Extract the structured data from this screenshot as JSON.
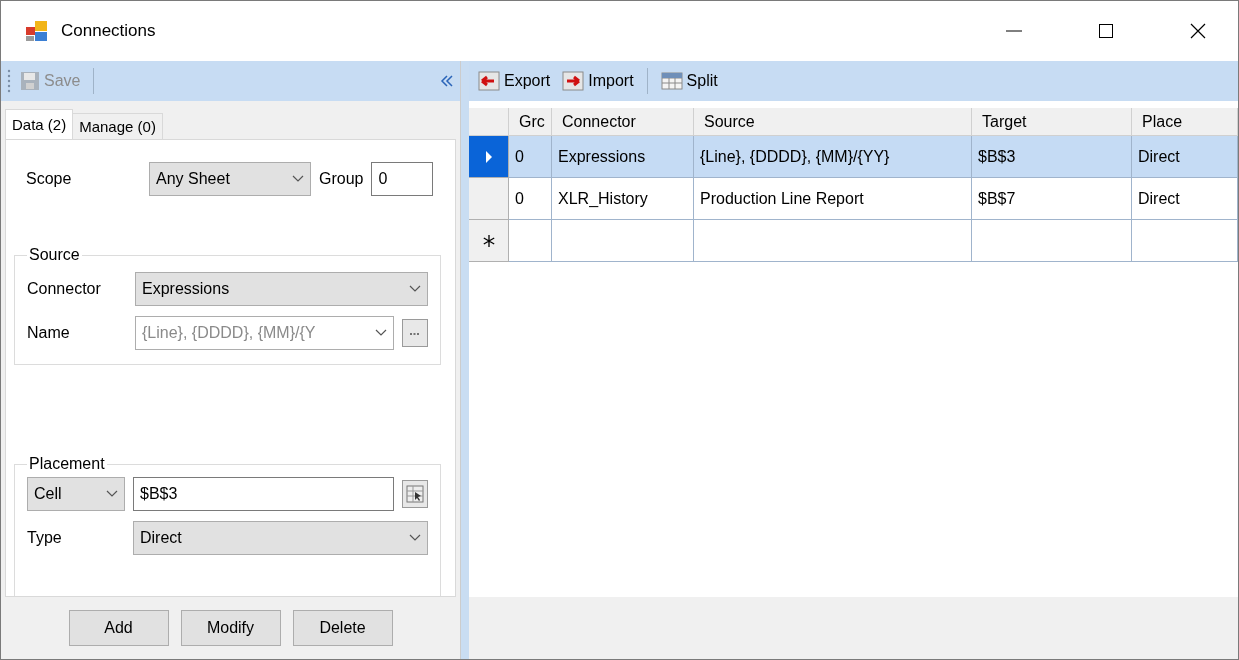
{
  "window": {
    "title": "Connections"
  },
  "left_toolbar": {
    "save": {
      "label": "Save",
      "disabled": true
    }
  },
  "tabs": [
    {
      "label": "Data (2)",
      "selected": true
    },
    {
      "label": "Manage (0)",
      "selected": false
    }
  ],
  "scope": {
    "label": "Scope",
    "value": "Any Sheet"
  },
  "group": {
    "label": "Group",
    "value": "0"
  },
  "source": {
    "title": "Source",
    "connector": {
      "label": "Connector",
      "value": "Expressions"
    },
    "name": {
      "label": "Name",
      "value": "{Line}, {DDDD}, {MM}/{Y",
      "disabled": true
    }
  },
  "placement": {
    "title": "Placement",
    "mode": "Cell",
    "target": "$B$3",
    "type": {
      "label": "Type",
      "value": "Direct"
    }
  },
  "buttons": [
    "Add",
    "Modify",
    "Delete"
  ],
  "right_toolbar": [
    {
      "kind": "export",
      "label": "Export"
    },
    {
      "kind": "import",
      "label": "Import"
    },
    {
      "kind": "split",
      "label": "Split"
    }
  ],
  "table": {
    "columns": [
      "Grc",
      "Connector",
      "Source",
      "Target",
      "Place"
    ],
    "rows": [
      {
        "selected": true,
        "cells": [
          "0",
          "Expressions",
          "{Line}, {DDDD}, {MM}/{YY}",
          "$B$3",
          "Direct"
        ]
      },
      {
        "selected": false,
        "cells": [
          "0",
          "XLR_History",
          "Production Line Report",
          "$B$7",
          "Direct"
        ]
      }
    ]
  }
}
